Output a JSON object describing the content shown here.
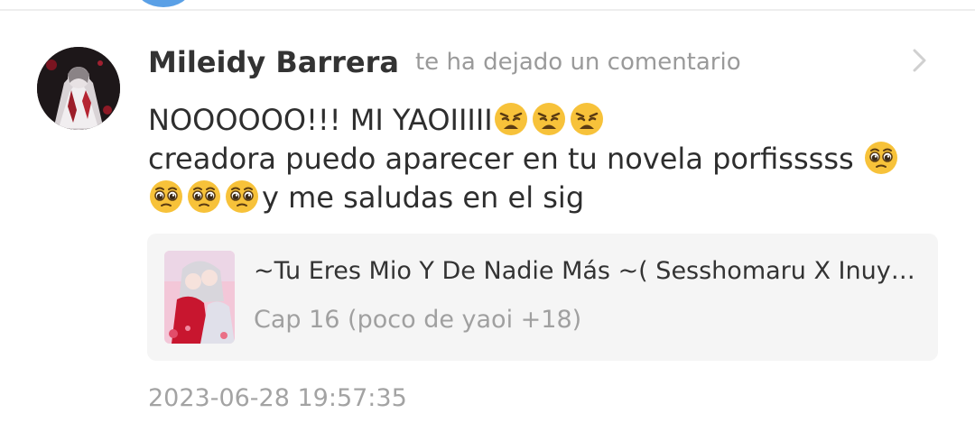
{
  "notification": {
    "username": "Mileidy Barrera",
    "action": "te ha dejado un comentario",
    "comment": {
      "line1": "NOOOOOO!!! MI YAOIIIII",
      "line1_emojis": [
        "weary-face",
        "weary-face",
        "weary-face"
      ],
      "line2": "creadora puedo aparecer en tu novela porfisssss ",
      "line2_emojis": [
        "pleading-face"
      ],
      "line3_emojis": [
        "pleading-face",
        "pleading-face",
        "pleading-face"
      ],
      "line3": "y me saludas en el sig"
    },
    "card": {
      "title": "~Tu Eres Mio Y De Nadie Más ~( Sesshomaru X Inuyasha )",
      "subtitle": "Cap 16 (poco de yaoi +18)"
    },
    "timestamp": "2023-06-28 19:57:35"
  },
  "icons": {
    "chevron": "chevron-right-icon",
    "emoji_weary": "weary-face",
    "emoji_pleading": "pleading-face"
  },
  "colors": {
    "username": "#333333",
    "secondary_text": "#9a9a9a",
    "card_background": "#f5f5f5",
    "emoji_yellow": "#f7c23a",
    "top_avatar_blue": "#5aa0e6"
  }
}
